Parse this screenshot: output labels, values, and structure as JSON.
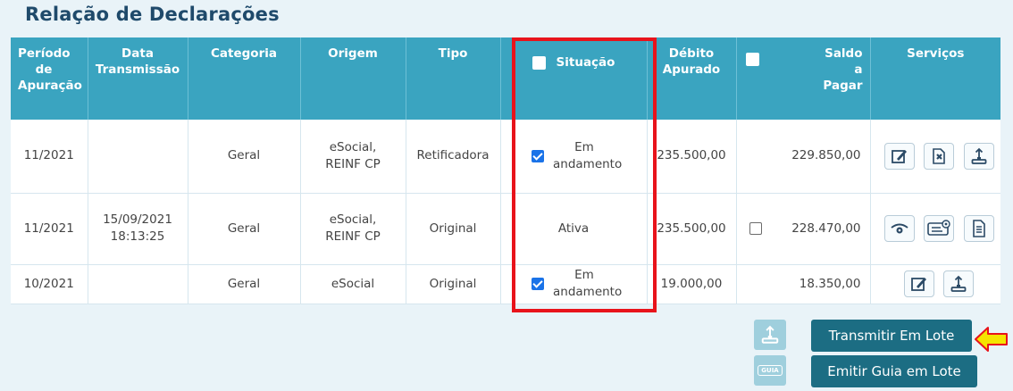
{
  "page": {
    "title": "Relação de Declarações"
  },
  "table": {
    "headers": {
      "periodo": "Período de Apuração",
      "data": "Data Transmissão",
      "categoria": "Categoria",
      "origem": "Origem",
      "tipo": "Tipo",
      "situacao": "Situação",
      "debito": "Débito Apurado",
      "saldo": "Saldo a Pagar",
      "servicos": "Serviços"
    },
    "rows": [
      {
        "periodo": "11/2021",
        "data_line1": "",
        "data_line2": "",
        "categoria": "Geral",
        "origem_line1": "eSocial,",
        "origem_line2": "REINF CP",
        "tipo": "Retificadora",
        "situacao_checked": true,
        "situacao_line1": "Em",
        "situacao_line2": "andamento",
        "debito": "235.500,00",
        "saldo_checkbox": false,
        "saldo": "229.850,00",
        "servicos": [
          "edit-icon",
          "delete-icon",
          "upload-icon"
        ]
      },
      {
        "periodo": "11/2021",
        "data_line1": "15/09/2021",
        "data_line2": "18:13:25",
        "categoria": "Geral",
        "origem_line1": "eSocial,",
        "origem_line2": "REINF CP",
        "tipo": "Original",
        "situacao_checked": false,
        "situacao_line1": "Ativa",
        "situacao_line2": "",
        "debito": "235.500,00",
        "saldo_checkbox": true,
        "saldo": "228.470,00",
        "servicos": [
          "view-icon",
          "ticket-icon",
          "document-icon"
        ]
      },
      {
        "periodo": "10/2021",
        "data_line1": "",
        "data_line2": "",
        "categoria": "Geral",
        "origem_line1": "eSocial",
        "origem_line2": "",
        "tipo": "Original",
        "situacao_checked": true,
        "situacao_line1": "Em",
        "situacao_line2": "andamento",
        "debito": "19.000,00",
        "saldo_checkbox": false,
        "saldo": "18.350,00",
        "servicos": [
          "edit-icon",
          "upload-icon"
        ]
      }
    ]
  },
  "actions": {
    "transmitir_lote": "Transmitir Em Lote",
    "emitir_guia_lote": "Emitir Guia em Lote",
    "guia_icon_text": "GUIA"
  },
  "colors": {
    "header_bg": "#3aa4c0",
    "title": "#1f4a6b",
    "negative": "#e0161e",
    "highlight": "#e8131b",
    "action_button": "#1c6d83",
    "arrow": "#f5e400"
  }
}
